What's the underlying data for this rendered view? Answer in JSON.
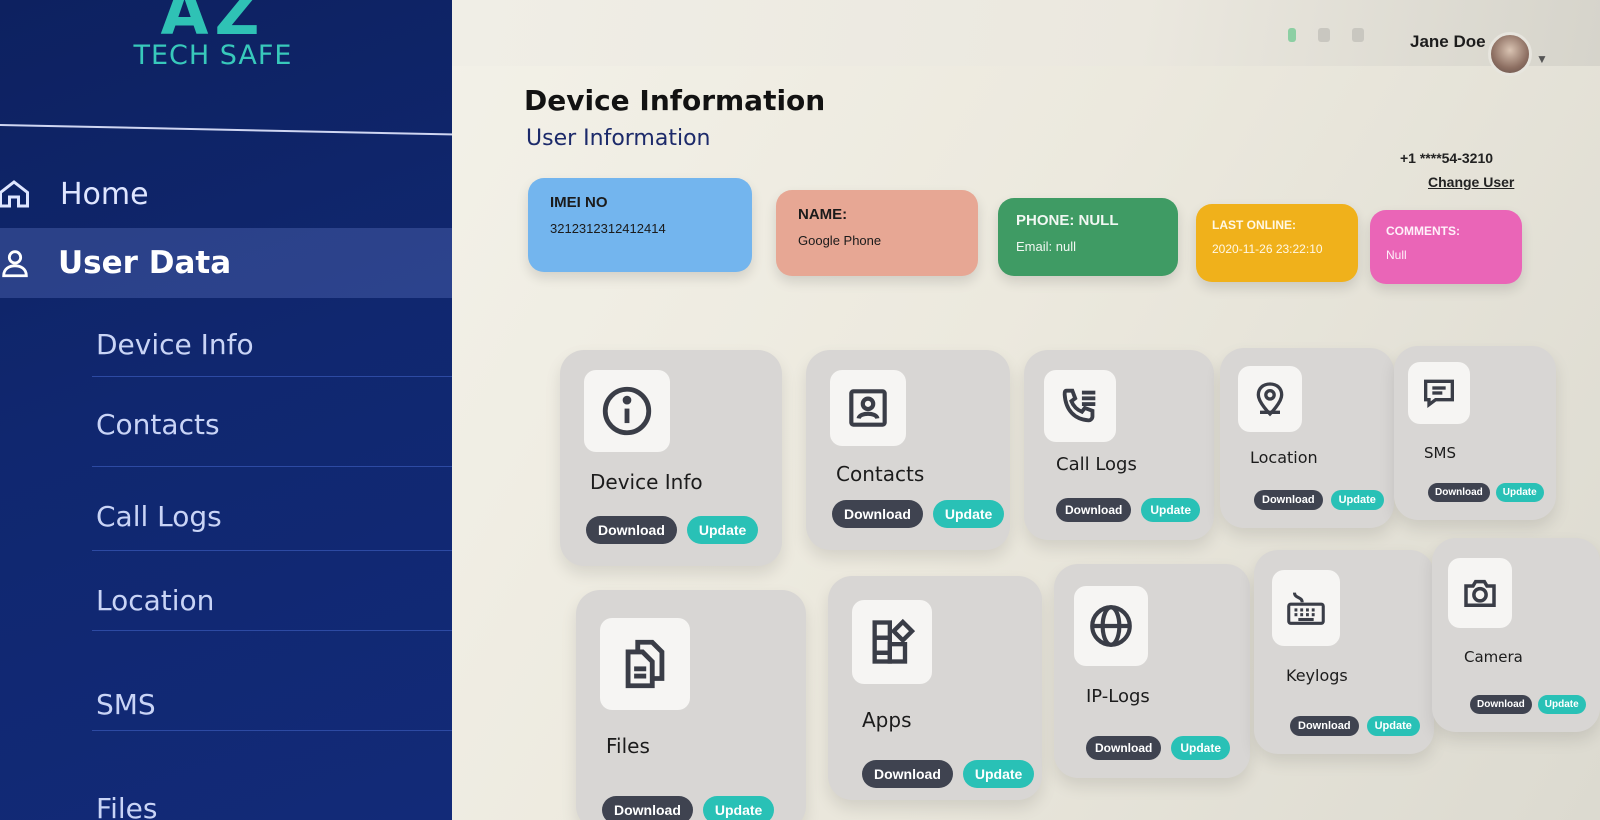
{
  "brand": {
    "mark": "AZ",
    "name": "TECH SAFE"
  },
  "sidebar": {
    "home": "Home",
    "user_data": "User Data",
    "items": [
      "Device Info",
      "Contacts",
      "Call Logs",
      "Location",
      "SMS",
      "Files"
    ]
  },
  "topbar": {
    "user_name": "Jane Doe"
  },
  "header": {
    "title": "Device Information",
    "subtitle": "User Information",
    "phone": "+1 ****54-3210",
    "change_user": "Change User"
  },
  "info_cards": {
    "imei": {
      "label": "IMEI NO",
      "value": "3212312312412414"
    },
    "name": {
      "label": "NAME:",
      "value": "Google Phone"
    },
    "phone": {
      "label": "PHONE: NULL",
      "value": "Email: null"
    },
    "last_online": {
      "label": "LAST ONLINE:",
      "value": "2020-11-26 23:22:10"
    },
    "comments": {
      "label": "COMMENTS:",
      "value": "Null"
    }
  },
  "buttons": {
    "download": "Download",
    "update": "Update"
  },
  "tiles": [
    {
      "title": "Device Info",
      "icon": "info-icon"
    },
    {
      "title": "Contacts",
      "icon": "contact-card-icon"
    },
    {
      "title": "Call Logs",
      "icon": "call-log-icon"
    },
    {
      "title": "Location",
      "icon": "location-pin-icon"
    },
    {
      "title": "SMS",
      "icon": "message-icon"
    },
    {
      "title": "Files",
      "icon": "files-icon"
    },
    {
      "title": "Apps",
      "icon": "apps-icon"
    },
    {
      "title": "IP-Logs",
      "icon": "globe-icon"
    },
    {
      "title": "Keylogs",
      "icon": "keyboard-icon"
    },
    {
      "title": "Camera",
      "icon": "camera-icon"
    }
  ]
}
